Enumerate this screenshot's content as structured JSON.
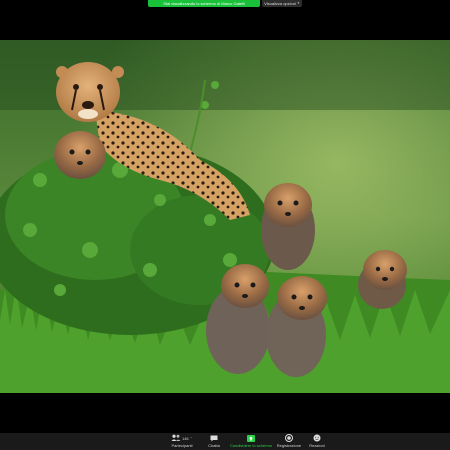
{
  "share_banner": {
    "text": "Stai visualizzando lo schermo di Marco Gatelli"
  },
  "view_options": {
    "label": "Visualizza opzioni",
    "chevron_icon": "chevron-down-icon"
  },
  "shared_content": {
    "description_icon": "photo"
  },
  "toolbar": {
    "participants": {
      "label": "Partecipanti",
      "count": "146",
      "icon": "people-icon"
    },
    "chat": {
      "label": "Chatta",
      "icon": "chat-icon"
    },
    "share_screen": {
      "label": "Condividere lo schermo",
      "icon": "share-screen-icon",
      "color": "#2ad14a"
    },
    "record": {
      "label": "Registrazione",
      "icon": "record-icon"
    },
    "reactions": {
      "label": "Reazioni",
      "icon": "reactions-icon"
    }
  }
}
